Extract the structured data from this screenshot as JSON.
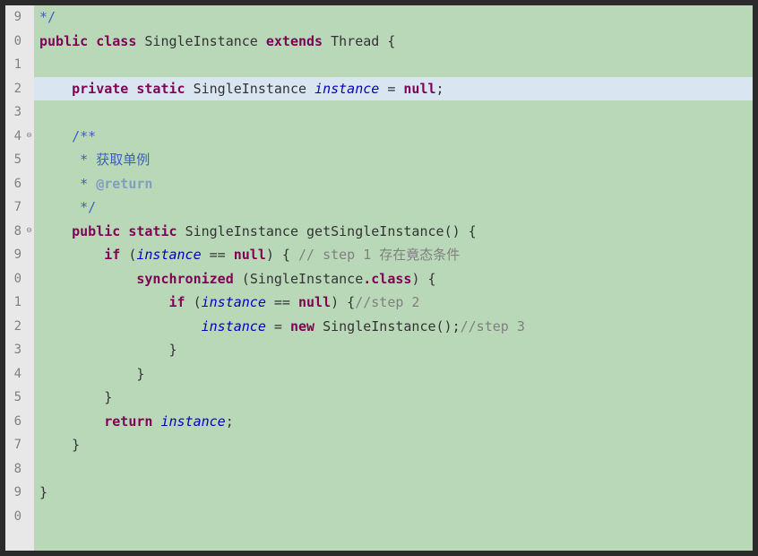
{
  "gutter": {
    "lines": [
      {
        "num": "9",
        "fold": false
      },
      {
        "num": "0",
        "fold": false
      },
      {
        "num": "1",
        "fold": false
      },
      {
        "num": "2",
        "fold": false
      },
      {
        "num": "3",
        "fold": false
      },
      {
        "num": "4",
        "fold": true
      },
      {
        "num": "5",
        "fold": false
      },
      {
        "num": "6",
        "fold": false
      },
      {
        "num": "7",
        "fold": false
      },
      {
        "num": "8",
        "fold": true
      },
      {
        "num": "9",
        "fold": false
      },
      {
        "num": "0",
        "fold": false
      },
      {
        "num": "1",
        "fold": false
      },
      {
        "num": "2",
        "fold": false
      },
      {
        "num": "3",
        "fold": false
      },
      {
        "num": "4",
        "fold": false
      },
      {
        "num": "5",
        "fold": false
      },
      {
        "num": "6",
        "fold": false
      },
      {
        "num": "7",
        "fold": false
      },
      {
        "num": "8",
        "fold": false
      },
      {
        "num": "9",
        "fold": false
      },
      {
        "num": "0",
        "fold": false
      }
    ]
  },
  "code": {
    "l0": {
      "indent": " ",
      "comment_close": "*/"
    },
    "l1": {
      "kw_public": "public",
      "kw_class": "class",
      "class_name": "SingleInstance",
      "kw_extends": "extends",
      "super_class": "Thread",
      "brace": " {"
    },
    "l2": {
      "blank": ""
    },
    "l3": {
      "indent": "    ",
      "kw_private": "private",
      "kw_static": "static",
      "type": "SingleInstance",
      "field": "instance",
      "eq": " = ",
      "kw_null": "null",
      "semi": ";"
    },
    "l4": {
      "blank": ""
    },
    "l5": {
      "indent": "    ",
      "javadoc_open": "/**"
    },
    "l6": {
      "indent": "     ",
      "star": "*",
      "text": " 获取单例"
    },
    "l7": {
      "indent": "     ",
      "star": "*",
      "tag": " @return"
    },
    "l8": {
      "indent": "     ",
      "javadoc_close": "*/"
    },
    "l9": {
      "indent": "    ",
      "kw_public": "public",
      "kw_static": "static",
      "ret_type": "SingleInstance",
      "method": "getSingleInstance",
      "parens": "()",
      "brace": " {"
    },
    "l10": {
      "indent": "        ",
      "kw_if": "if",
      "open": " (",
      "field": "instance",
      "op": " == ",
      "kw_null": "null",
      "close": ") {",
      "comment": " // step 1 存在竟态条件"
    },
    "l11": {
      "indent": "            ",
      "kw_sync": "synchronized",
      "open": " (",
      "cls": "SingleInstance",
      "dot_class": ".class",
      "close": ") {"
    },
    "l12": {
      "indent": "                ",
      "kw_if": "if",
      "open": " (",
      "field": "instance",
      "op": " == ",
      "kw_null": "null",
      "close": ") {",
      "comment": "//step 2"
    },
    "l13": {
      "indent": "                    ",
      "field": "instance",
      "eq": " = ",
      "kw_new": "new",
      "ctor": " SingleInstance()",
      "semi": ";",
      "comment": "//step 3"
    },
    "l14": {
      "indent": "                ",
      "brace": "}"
    },
    "l15": {
      "indent": "            ",
      "brace": "}"
    },
    "l16": {
      "indent": "        ",
      "brace": "}"
    },
    "l17": {
      "indent": "        ",
      "kw_return": "return",
      "field": " instance",
      "semi": ";"
    },
    "l18": {
      "indent": "    ",
      "brace": "}"
    },
    "l19": {
      "blank": ""
    },
    "l20": {
      "brace": "}"
    },
    "l21": {
      "blank": ""
    }
  }
}
